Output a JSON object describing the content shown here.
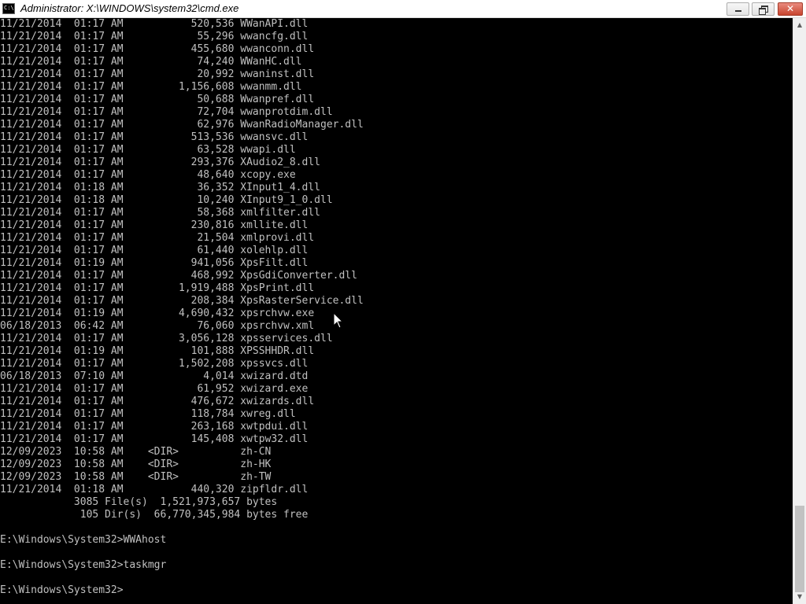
{
  "window": {
    "title": "Administrator: X:\\WINDOWS\\system32\\cmd.exe",
    "icon_label": "C:\\",
    "controls": {
      "minimize_icon": "minimize-icon",
      "maximize_icon": "restore-icon",
      "close_icon": "close-icon",
      "close_glyph": "✕"
    }
  },
  "colors": {
    "console_bg": "#000000",
    "console_fg": "#c0c0c0",
    "titlebar_bg": "#ffffff",
    "close_button": "#c8452f"
  },
  "console": {
    "lines": [
      "11/21/2014  01:17 AM           520,536 WWanAPI.dll",
      "11/21/2014  01:17 AM            55,296 wwancfg.dll",
      "11/21/2014  01:17 AM           455,680 wwanconn.dll",
      "11/21/2014  01:17 AM            74,240 WWanHC.dll",
      "11/21/2014  01:17 AM            20,992 wwaninst.dll",
      "11/21/2014  01:17 AM         1,156,608 wwanmm.dll",
      "11/21/2014  01:17 AM            50,688 Wwanpref.dll",
      "11/21/2014  01:17 AM            72,704 wwanprotdim.dll",
      "11/21/2014  01:17 AM            62,976 WwanRadioManager.dll",
      "11/21/2014  01:17 AM           513,536 wwansvc.dll",
      "11/21/2014  01:17 AM            63,528 wwapi.dll",
      "11/21/2014  01:17 AM           293,376 XAudio2_8.dll",
      "11/21/2014  01:17 AM            48,640 xcopy.exe",
      "11/21/2014  01:18 AM            36,352 XInput1_4.dll",
      "11/21/2014  01:18 AM            10,240 XInput9_1_0.dll",
      "11/21/2014  01:17 AM            58,368 xmlfilter.dll",
      "11/21/2014  01:17 AM           230,816 xmllite.dll",
      "11/21/2014  01:17 AM            21,504 xmlprovi.dll",
      "11/21/2014  01:17 AM            61,440 xolehlp.dll",
      "11/21/2014  01:19 AM           941,056 XpsFilt.dll",
      "11/21/2014  01:17 AM           468,992 XpsGdiConverter.dll",
      "11/21/2014  01:17 AM         1,919,488 XpsPrint.dll",
      "11/21/2014  01:17 AM           208,384 XpsRasterService.dll",
      "11/21/2014  01:19 AM         4,690,432 xpsrchvw.exe",
      "06/18/2013  06:42 AM            76,060 xpsrchvw.xml",
      "11/21/2014  01:17 AM         3,056,128 xpsservices.dll",
      "11/21/2014  01:19 AM           101,888 XPSSHHDR.dll",
      "11/21/2014  01:17 AM         1,502,208 xpssvcs.dll",
      "06/18/2013  07:10 AM             4,014 xwizard.dtd",
      "11/21/2014  01:17 AM            61,952 xwizard.exe",
      "11/21/2014  01:17 AM           476,672 xwizards.dll",
      "11/21/2014  01:17 AM           118,784 xwreg.dll",
      "11/21/2014  01:17 AM           263,168 xwtpdui.dll",
      "11/21/2014  01:17 AM           145,408 xwtpw32.dll",
      "12/09/2023  10:58 AM    <DIR>          zh-CN",
      "12/09/2023  10:58 AM    <DIR>          zh-HK",
      "12/09/2023  10:58 AM    <DIR>          zh-TW",
      "11/21/2014  01:18 AM           440,320 zipfldr.dll",
      "            3085 File(s)  1,521,973,657 bytes",
      "             105 Dir(s)  66,770,345,984 bytes free",
      "",
      "E:\\Windows\\System32>WWAhost",
      "",
      "E:\\Windows\\System32>taskmgr",
      "",
      "E:\\Windows\\System32>"
    ]
  },
  "scrollbar": {
    "up_arrow": "▲",
    "down_arrow": "▼",
    "position_fraction": 0.97
  },
  "cursor_icon": "mouse-pointer-icon"
}
